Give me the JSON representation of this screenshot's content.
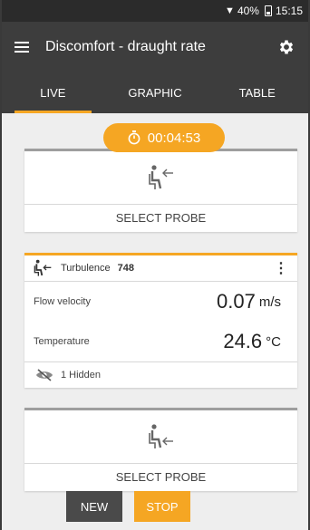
{
  "status_bar": {
    "battery": "40%",
    "time": "15:15"
  },
  "header": {
    "title": "Discomfort - draught rate"
  },
  "tabs": [
    {
      "label": "LIVE",
      "active": true
    },
    {
      "label": "GRAPHIC",
      "active": false
    },
    {
      "label": "TABLE",
      "active": false
    }
  ],
  "timer": "00:04:53",
  "probe_slot_1": {
    "label": "SELECT PROBE"
  },
  "measurement_card": {
    "sensor_name": "Turbulence",
    "sensor_id": "748",
    "readings": [
      {
        "label": "Flow velocity",
        "value": "0.07",
        "unit": "m/s"
      },
      {
        "label": "Temperature",
        "value": "24.6",
        "unit": "°C"
      }
    ],
    "hidden_text": "1 Hidden"
  },
  "probe_slot_2": {
    "label": "SELECT PROBE"
  },
  "buttons": {
    "new": "NEW",
    "stop": "STOP"
  },
  "colors": {
    "accent": "#f5a623",
    "appbar": "#3d3d3d",
    "statusbar": "#2b2b2b"
  },
  "icons": [
    "menu-icon",
    "gear-icon",
    "stopwatch-icon",
    "seated-person-draught-icon",
    "more-vert-icon",
    "eye-off-icon",
    "wifi-icon",
    "battery-icon"
  ]
}
